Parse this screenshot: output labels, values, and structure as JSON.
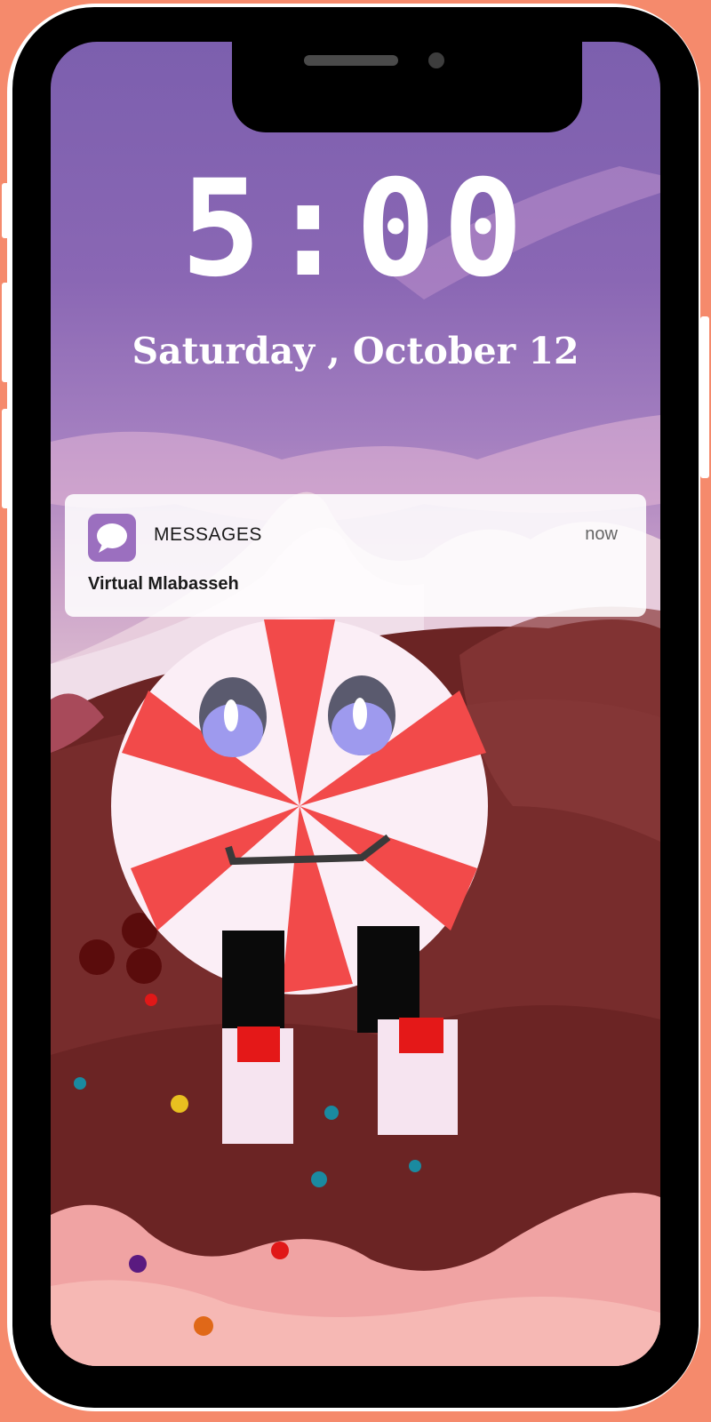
{
  "lock_screen": {
    "time": "5:00",
    "date": "Saturday , October 12"
  },
  "notification": {
    "app_name": "MESSAGES",
    "timestamp": "now",
    "message": "Virtual Mlabasseh",
    "icon": "message-bubble-icon",
    "icon_color": "#9b6fbf"
  },
  "wallpaper": {
    "subject": "peppermint-candy-character",
    "sky_color": "#8a67b4",
    "chocolate_color": "#6b2424"
  },
  "frame_color": "#f58a6c"
}
